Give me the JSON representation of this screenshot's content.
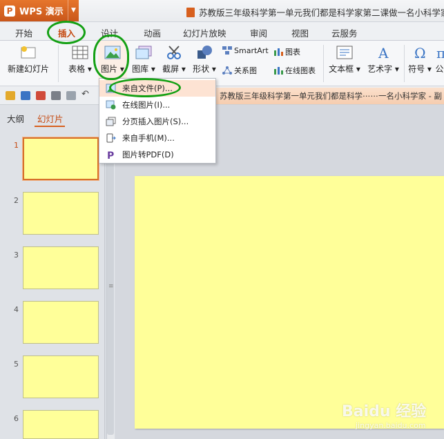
{
  "app": {
    "name": "WPS 演示",
    "logo": "P"
  },
  "title": "苏教版三年级科学第一单元我们都是科学家第二课做一名小科学家",
  "tabs": [
    {
      "label": "开始"
    },
    {
      "label": "插入",
      "active": true
    },
    {
      "label": "设计"
    },
    {
      "label": "动画"
    },
    {
      "label": "幻灯片放映"
    },
    {
      "label": "审阅"
    },
    {
      "label": "视图"
    },
    {
      "label": "云服务"
    }
  ],
  "ribbon": {
    "new_slide": "新建幻灯片",
    "table": "表格",
    "picture": "图片",
    "gallery": "图库",
    "screenshot": "截屏",
    "shapes": "形状",
    "smartart": "SmartArt",
    "chart": "图表",
    "relation": "关系图",
    "online_chart": "在线图表",
    "textbox": "文本框",
    "wordart": "艺术字",
    "symbol": "符号",
    "formula": "公"
  },
  "document_tab": "苏教版三年级科学第一单元我们都是科学⋯⋯一名小科学家 - 副",
  "left_panel": {
    "tabs": [
      {
        "label": "大纲"
      },
      {
        "label": "幻灯片",
        "active": true
      }
    ],
    "slides": [
      "1",
      "2",
      "3",
      "4",
      "5",
      "6"
    ],
    "slide_color": "#ffff99"
  },
  "picture_menu": {
    "items": [
      {
        "label": "来自文件(P)...",
        "highlighted": true
      },
      {
        "label": "在线图片(I)..."
      },
      {
        "label": "分页插入图片(S)..."
      },
      {
        "label": "来自手机(M)..."
      },
      {
        "label": "图片转PDF(D)"
      }
    ]
  },
  "watermark": {
    "text": "Baidu 经验",
    "sub": "jingyan.baidu.com"
  },
  "colors": {
    "accent": "#d75f1d",
    "annotation": "#14a014",
    "slide": "#ffff99"
  }
}
